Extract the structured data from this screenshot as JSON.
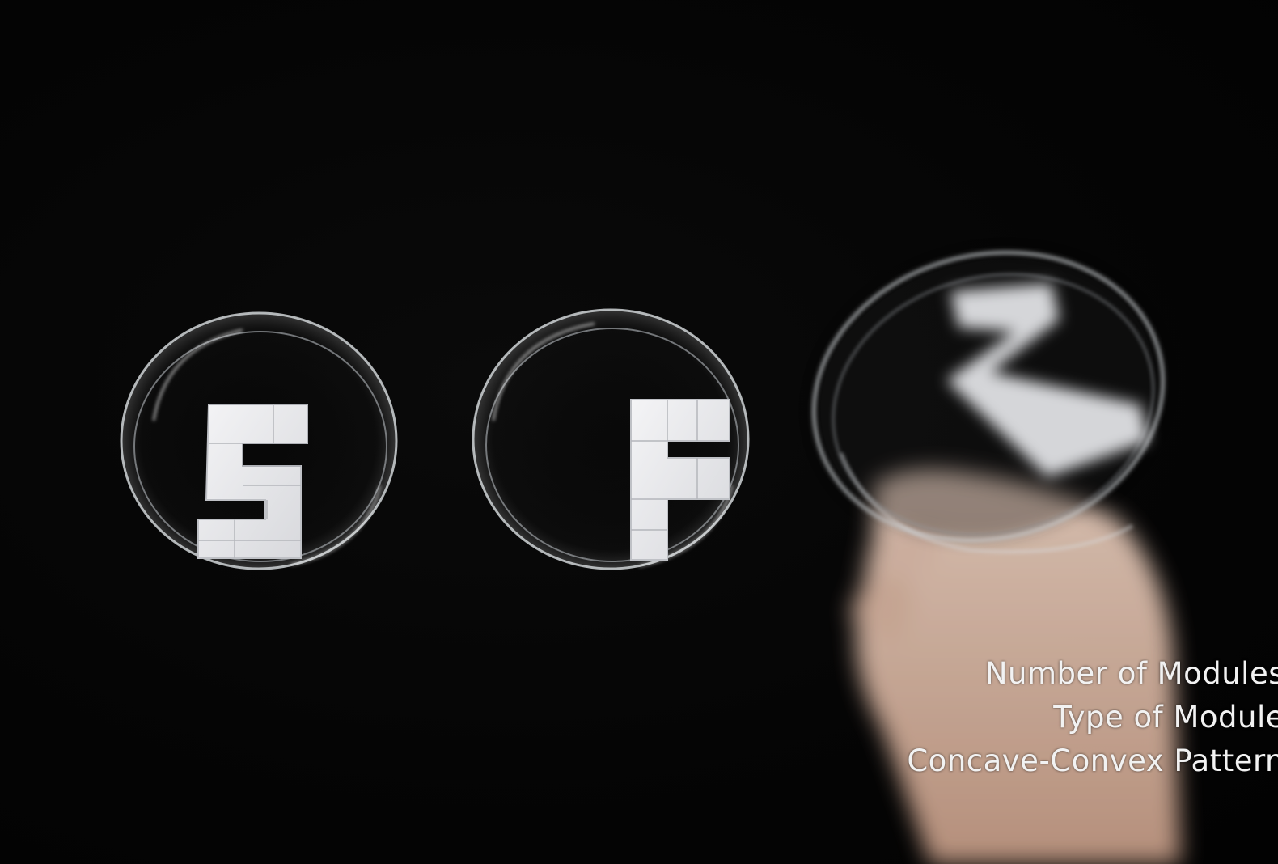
{
  "caption": {
    "line1": "Number of Modules",
    "line2": "Type of Module",
    "line3": "Concave-Convex Pattern"
  },
  "colors": {
    "background": "#000000",
    "modules": "#e8e8ea",
    "dish_rim": "#cfd3d6",
    "skin": "#d9b9a6",
    "caption_text": "#f2f2f2"
  },
  "objects": [
    "petri-dish-with-S-blocks",
    "petri-dish-with-F-blocks",
    "petri-dish-with-Z-blocks-in-motion",
    "hand"
  ]
}
